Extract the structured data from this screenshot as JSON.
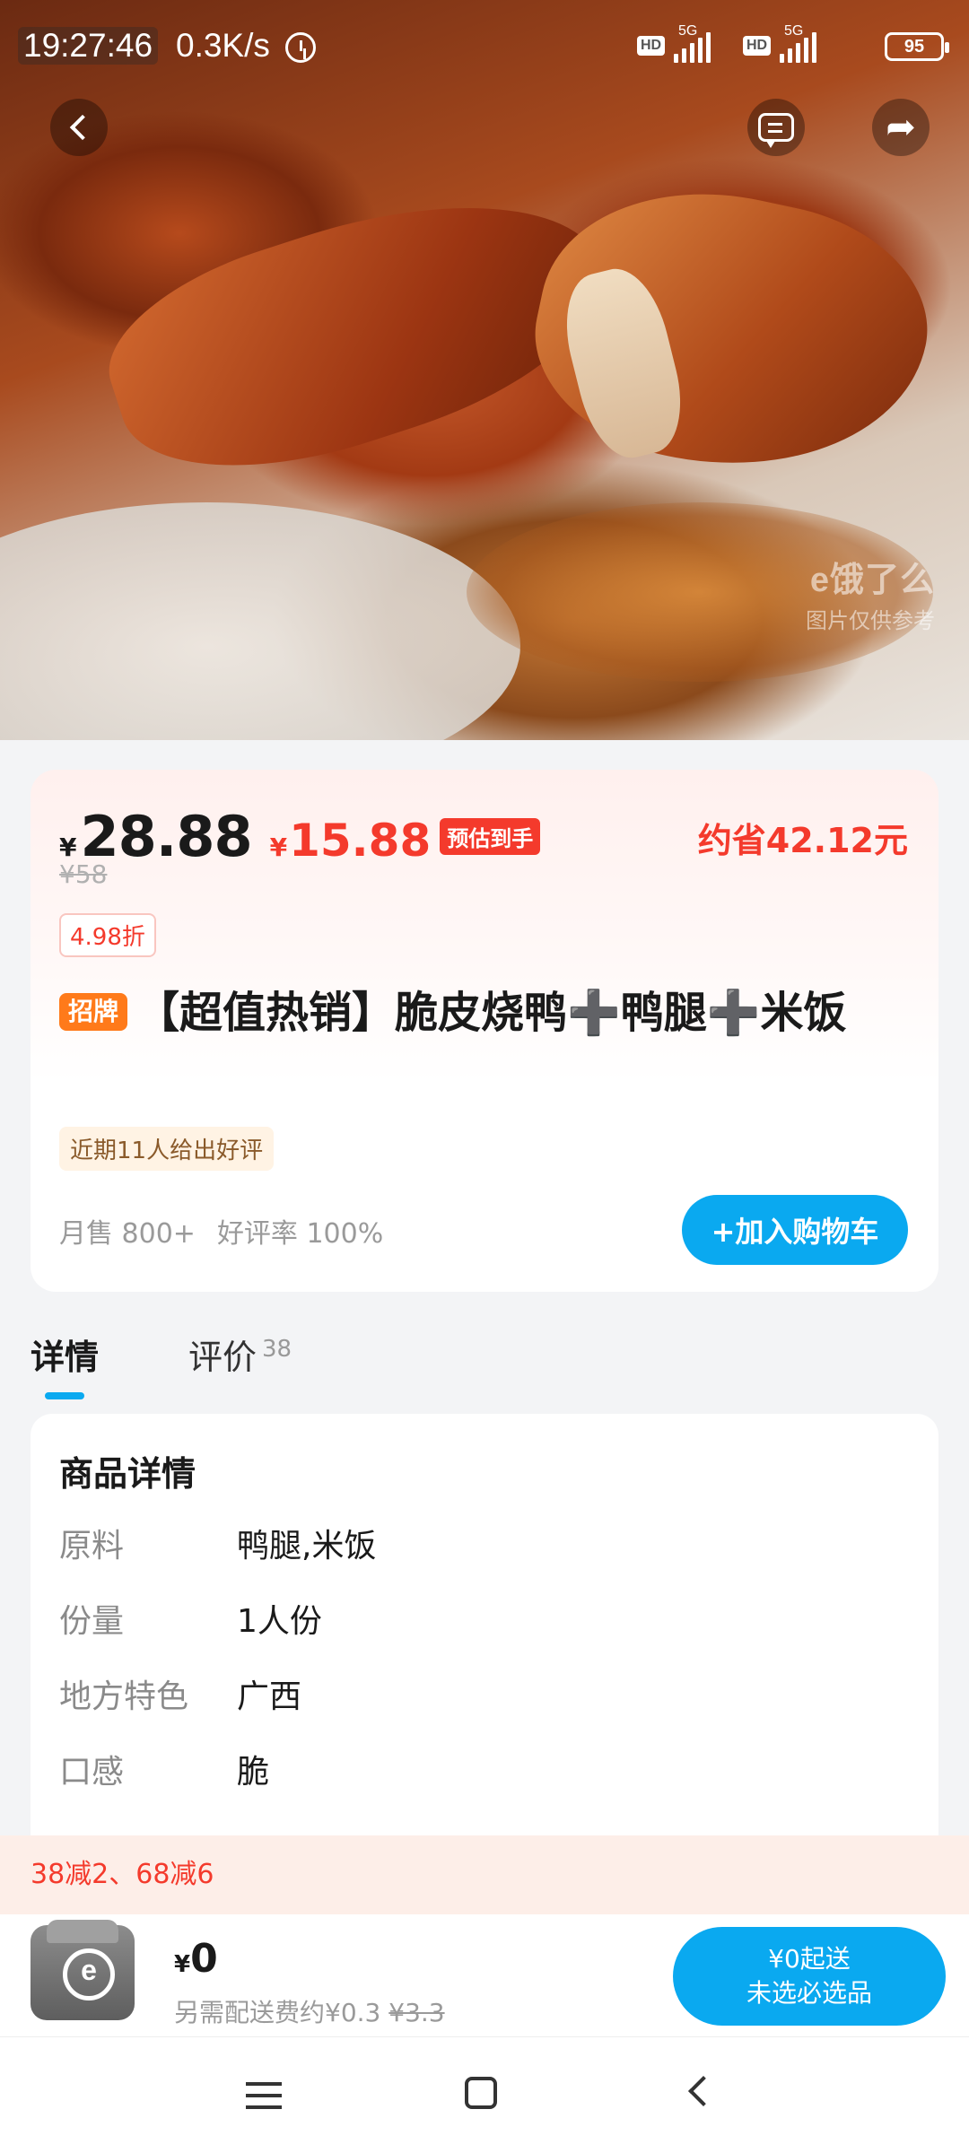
{
  "status_bar": {
    "time": "19:27:46",
    "speed": "0.3K/s",
    "battery": "95",
    "network": "5G",
    "hd": "HD"
  },
  "hero": {
    "watermark_logo": "e饿了么",
    "watermark_text": "图片仅供参考"
  },
  "product": {
    "price_symbol": "¥",
    "price": "28.88",
    "final_symbol": "¥",
    "final_price": "15.88",
    "estimate_tag": "预估到手",
    "original_price": "¥58",
    "save_text": "约省42.12元",
    "discount": "4.98折",
    "badge": "招牌",
    "title": "【超值热销】脆皮烧鸭➕鸭腿➕米饭",
    "praise": "近期11人给出好评",
    "monthly_sales": "月售 800+",
    "rating": "好评率 100%",
    "add_cart": "+加入购物车"
  },
  "tabs": {
    "detail": "详情",
    "review": "评价",
    "review_count": "38"
  },
  "details": {
    "title": "商品详情",
    "rows": [
      {
        "label": "原料",
        "value": "鸭腿,米饭"
      },
      {
        "label": "份量",
        "value": "1人份"
      },
      {
        "label": "地方特色",
        "value": "广西"
      },
      {
        "label": "口感",
        "value": "脆"
      }
    ]
  },
  "promo": "38减2、68减6",
  "bottom": {
    "total_symbol": "¥",
    "total": "0",
    "delivery_prefix": "另需配送费约¥0.3",
    "delivery_strike": "¥3.3",
    "checkout_line1": "¥0起送",
    "checkout_line2": "未选必选品"
  },
  "colors": {
    "accent_blue": "#0aa9f0",
    "price_red": "#f43a2c",
    "badge_orange": "#ff7a1a"
  }
}
